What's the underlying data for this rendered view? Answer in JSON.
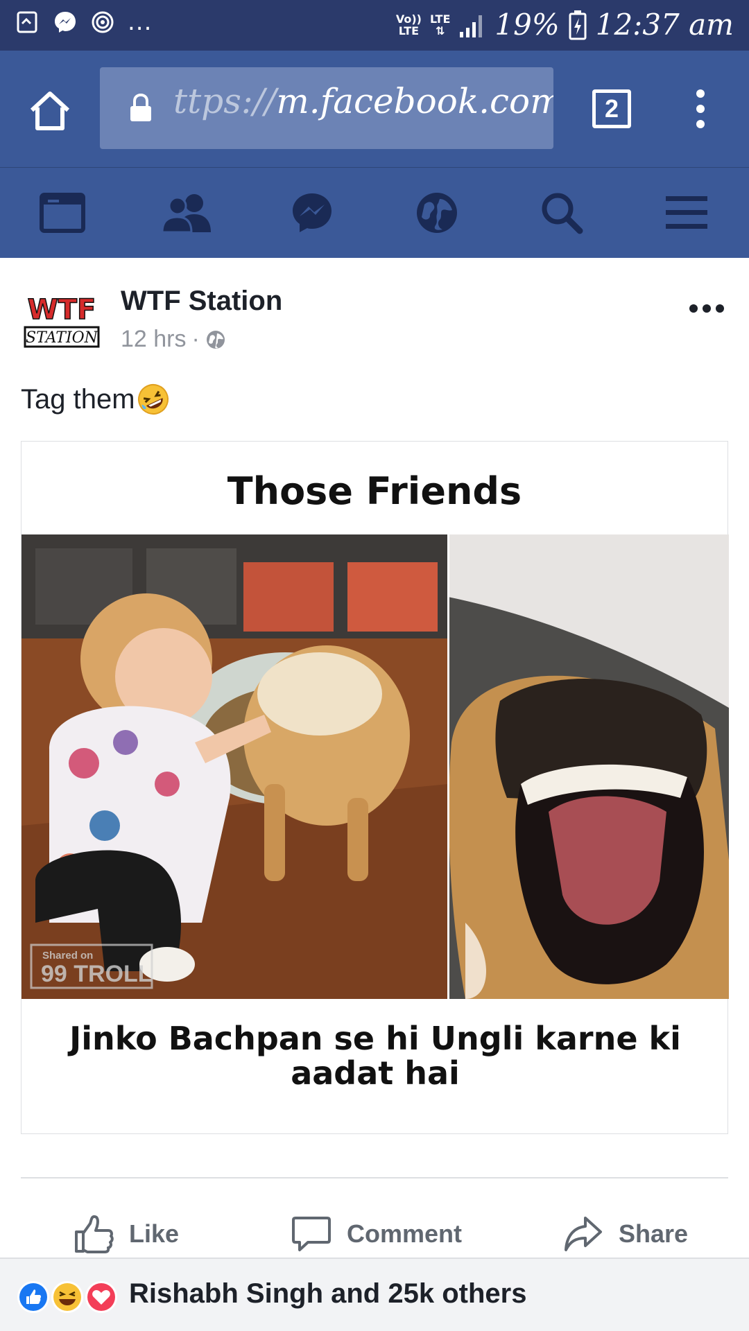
{
  "status_bar": {
    "left_icons": [
      "screenshot-icon",
      "messenger-icon",
      "radio-icon"
    ],
    "more": "...",
    "volte_top": "Vo))",
    "volte_bottom": "LTE",
    "lte": "LTE",
    "battery": "19%",
    "time": "12:37 am"
  },
  "browser": {
    "url_faded": "ttps://",
    "url_main": "m.facebook.com/",
    "url_tail": ":",
    "tab_count": "2"
  },
  "fb_nav": {
    "items": [
      "news-feed",
      "friend-requests",
      "messages",
      "notifications",
      "search",
      "menu"
    ],
    "accent": "#3b5998"
  },
  "post": {
    "author": "WTF Station",
    "time": "12 hrs",
    "separator": "·",
    "caption": "Tag them",
    "image_title": "Those Friends",
    "image_caption": "Jinko Bachpan se hi Ungli karne ki aadat hai",
    "watermark_line1": "Shared on",
    "watermark_line2": "99 TROLL",
    "avatar_text_top": "WTF",
    "avatar_text_bottom": "STATION"
  },
  "actions": {
    "like": "Like",
    "comment": "Comment",
    "share": "Share"
  },
  "reactions": {
    "summary": "Rishabh Singh and 25k others",
    "types": [
      "like",
      "haha",
      "love"
    ]
  }
}
